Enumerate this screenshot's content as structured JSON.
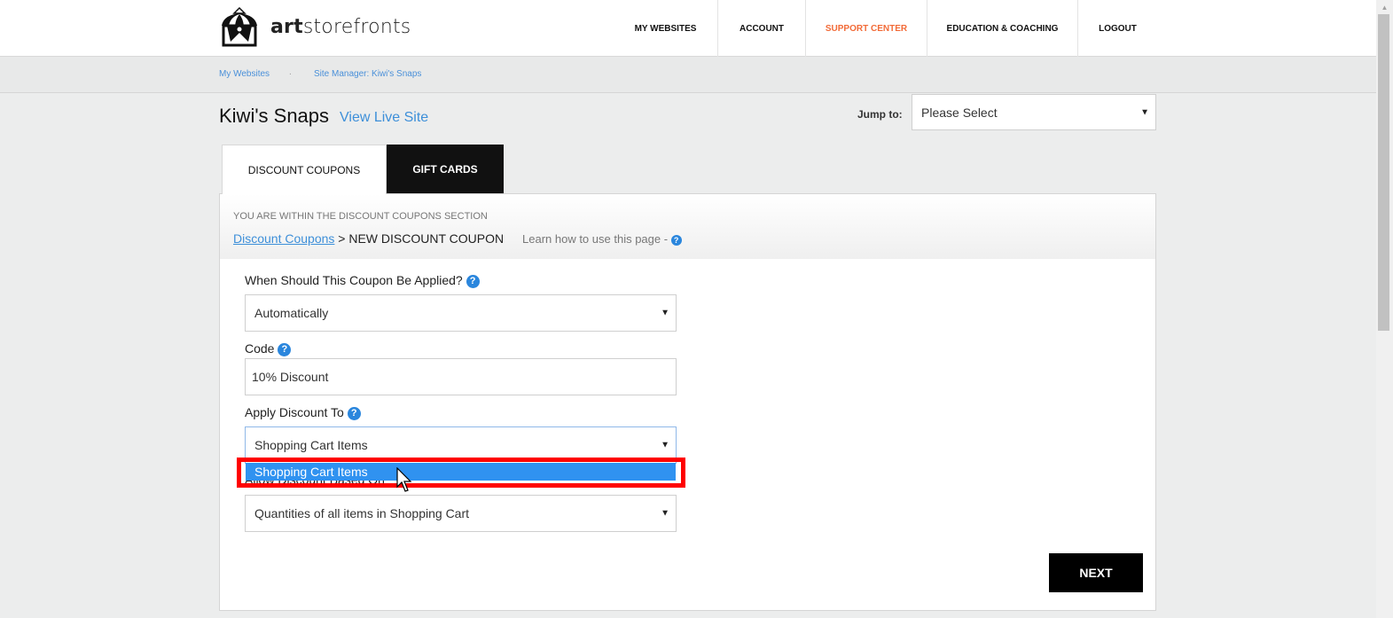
{
  "header": {
    "logo_bold": "art",
    "logo_light": "storefronts",
    "nav": [
      {
        "label": "MY WEBSITES",
        "active": false
      },
      {
        "label": "ACCOUNT",
        "active": false
      },
      {
        "label": "SUPPORT CENTER",
        "active": true
      },
      {
        "label": "EDUCATION & COACHING",
        "active": false
      },
      {
        "label": "LOGOUT",
        "active": false
      }
    ],
    "accent_color": "#f26b38"
  },
  "breadcrumb": {
    "items": [
      "My Websites",
      "Site Manager: Kiwi's Snaps"
    ],
    "separator": "."
  },
  "page": {
    "title": "Kiwi's Snaps",
    "view_live_label": "View Live Site",
    "jump_label": "Jump to:",
    "jump_value": "Please Select"
  },
  "tabs": [
    {
      "label": "DISCOUNT COUPONS",
      "active": true
    },
    {
      "label": "GIFT CARDS",
      "active": false
    }
  ],
  "panel": {
    "section_note": "YOU ARE WITHIN THE DISCOUNT COUPONS SECTION",
    "path_link": "Discount Coupons",
    "path_current": " > NEW DISCOUNT COUPON",
    "learn_label": "Learn how to use this page - ",
    "help_glyph": "?"
  },
  "form": {
    "when_label": "When Should This Coupon Be Applied?",
    "when_value": "Automatically",
    "code_label": "Code",
    "code_value": "10% Discount",
    "apply_label": "Apply Discount To",
    "apply_value": "Shopping Cart Items",
    "apply_options": [
      "Shopping Cart Items"
    ],
    "based_label": "Allow Discount Based On",
    "based_value": "Quantities of all items in Shopping Cart",
    "next_label": "NEXT",
    "arrow_glyph": "▼"
  }
}
